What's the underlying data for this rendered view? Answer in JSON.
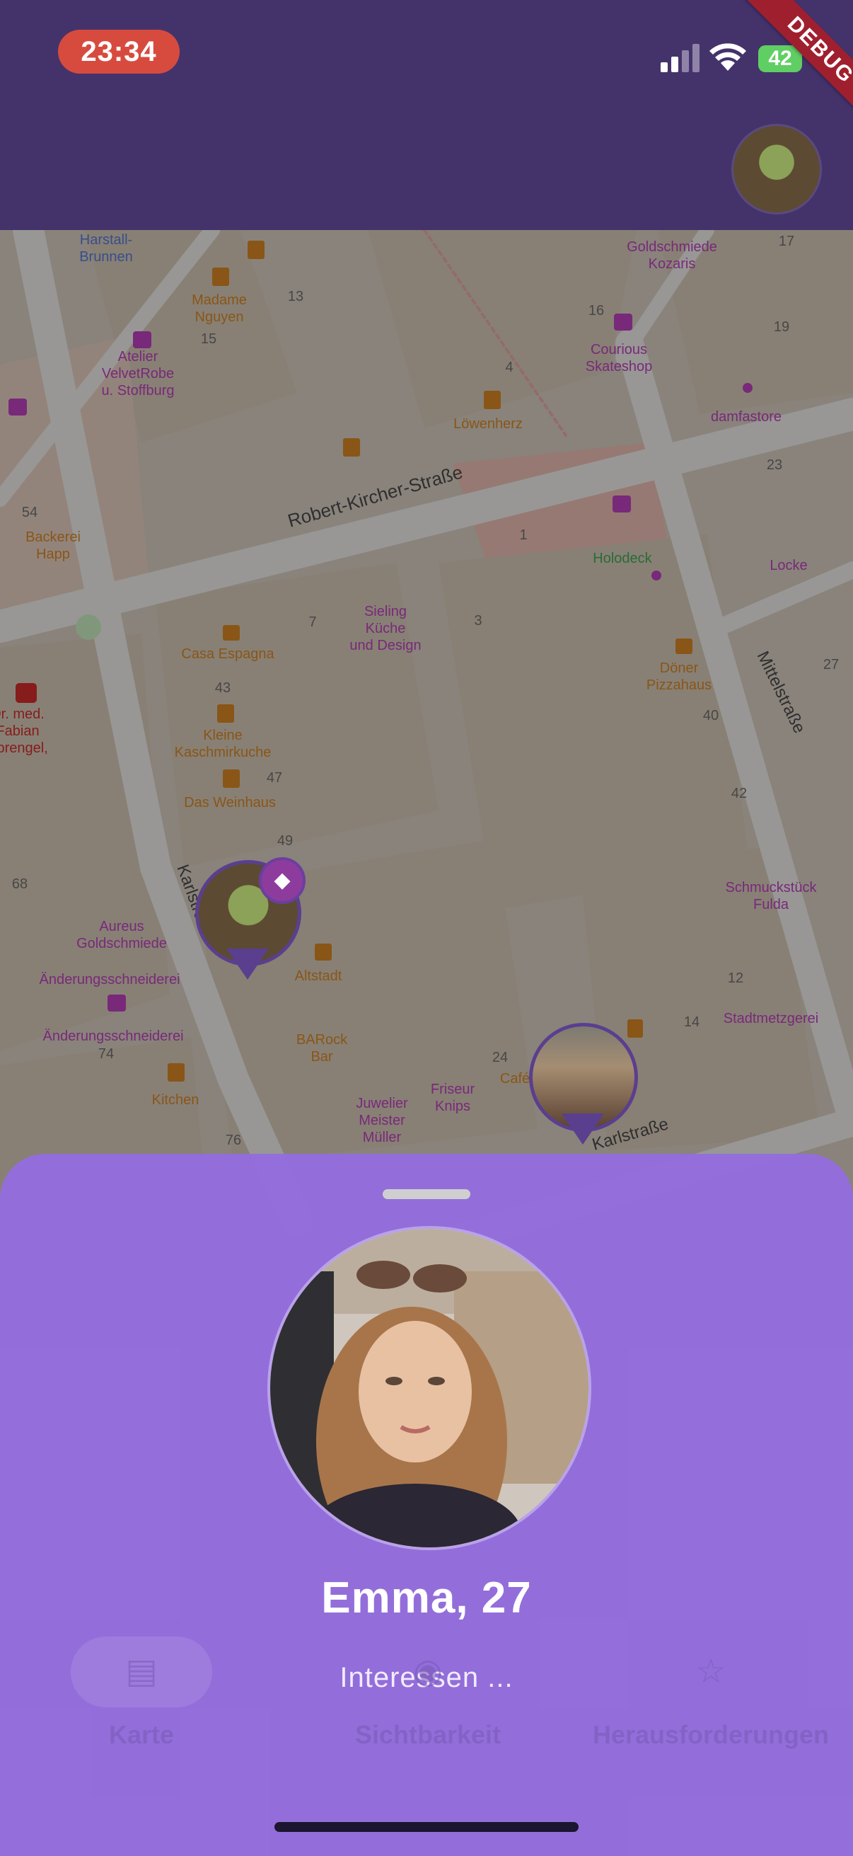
{
  "status_bar": {
    "time": "23:34",
    "battery": "42",
    "debug_banner": "DEBUG"
  },
  "map": {
    "streets": [
      "Robert-Kircher-Straße",
      "Mittelstraße",
      "Karlstraße",
      "Karlstraße"
    ],
    "places": [
      {
        "name": "Harstall-",
        "sub": "Brunnen",
        "color": "#3f5fb5"
      },
      {
        "name": "Madame",
        "sub": "Nguyen",
        "color": "#b46a10"
      },
      {
        "name": "Goldschmiede",
        "sub": "Kozaris",
        "color": "#9c2a9c"
      },
      {
        "name": "Atelier",
        "sub": "VelvetRobe",
        "sub2": "u. Stoffburg",
        "color": "#9c2a9c"
      },
      {
        "name": "Courious",
        "sub": "Skateshop",
        "color": "#9c2a9c"
      },
      {
        "name": "Löwenherz",
        "color": "#b46a10"
      },
      {
        "name": "damfastore",
        "color": "#9c2a9c"
      },
      {
        "name": "Backerei",
        "sub": "Happ",
        "color": "#b46a10"
      },
      {
        "name": "Holodeck",
        "color": "#2a8a3a"
      },
      {
        "name": "Locke",
        "color": "#9c2a9c"
      },
      {
        "name": "Sieling",
        "sub": "Küche",
        "sub2": "und Design",
        "color": "#9c2a9c"
      },
      {
        "name": "Casa Espagna",
        "color": "#b46a10"
      },
      {
        "name": "Döner",
        "sub": "Pizzahaus",
        "color": "#b46a10"
      },
      {
        "name": "Kleine",
        "sub": "Kaschmirkuche",
        "color": "#b46a10"
      },
      {
        "name": "Das Weinhaus",
        "color": "#b46a10"
      },
      {
        "name": "Aureus",
        "sub": "Goldschmiede",
        "color": "#9c2a9c"
      },
      {
        "name": "Schmuckstück",
        "sub": "Fulda",
        "color": "#9c2a9c"
      },
      {
        "name": "Änderungsschneiderei",
        "color": "#9c2a9c"
      },
      {
        "name": "Änderungsschneiderei",
        "color": "#9c2a9c"
      },
      {
        "name": "Altstadt",
        "color": "#b46a10"
      },
      {
        "name": "Stadtmetzgerei",
        "color": "#9c2a9c"
      },
      {
        "name": "BARock",
        "sub": "Bar",
        "color": "#b46a10"
      },
      {
        "name": "Kitchen",
        "color": "#b46a10"
      },
      {
        "name": "Juwelier",
        "sub": "Meister",
        "sub2": "Müller",
        "color": "#9c2a9c"
      },
      {
        "name": "Friseur",
        "sub": "Knips",
        "color": "#9c2a9c"
      },
      {
        "name": "Café",
        "color": "#b46a10"
      },
      {
        "name": "Dr. med.",
        "sub": "Fabian",
        "sub2": "Sprengel,",
        "color": "#b01818"
      }
    ],
    "house_numbers": [
      "13",
      "15",
      "16",
      "17",
      "19",
      "4",
      "23",
      "54",
      "1",
      "7",
      "3",
      "43",
      "47",
      "49",
      "40",
      "27",
      "42",
      "68",
      "74",
      "12",
      "14",
      "24",
      "76"
    ]
  },
  "profile_sheet": {
    "name_age": "Emma, 27",
    "interests": "Interessen ..."
  },
  "bottom_nav": {
    "items": [
      {
        "label": "Karte",
        "icon": "map-icon"
      },
      {
        "label": "Sichtbarkeit",
        "icon": "visibility-icon"
      },
      {
        "label": "Herausforderungen",
        "icon": "trophy-icon"
      }
    ]
  }
}
